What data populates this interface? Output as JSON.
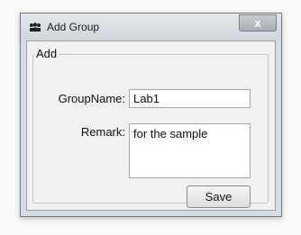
{
  "window": {
    "title": "Add Group",
    "close_label": "x"
  },
  "form": {
    "group_title": "Add",
    "group_name_label": "GroupName:",
    "group_name_value": "Lab1",
    "remark_label": "Remark:",
    "remark_value": "for the sample",
    "save_label": "Save"
  },
  "icons": {
    "app": "group-icon",
    "close": "close-icon"
  }
}
